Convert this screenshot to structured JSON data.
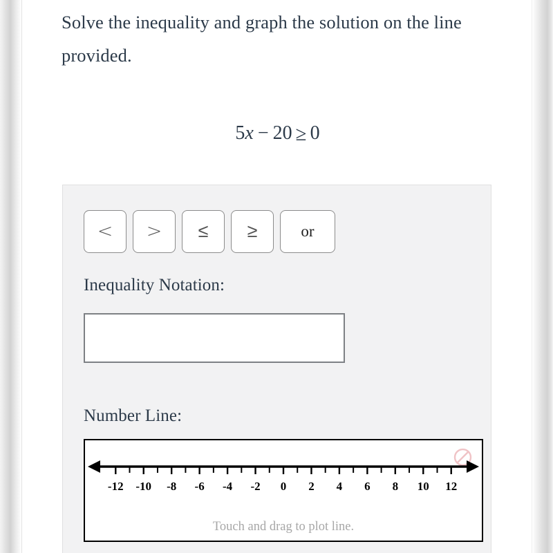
{
  "prompt": {
    "text": "Solve the inequality and graph the solution on the line provided."
  },
  "equation": {
    "full": "5x − 20 ≥ 0",
    "coefficient": "5",
    "variable": "x",
    "operator": "−",
    "constant": "20",
    "relation": "≥",
    "right_side": "0"
  },
  "panel": {
    "operator_keys": [
      {
        "label": "<",
        "name": "less-than"
      },
      {
        "label": ">",
        "name": "greater-than"
      },
      {
        "label": "≤",
        "name": "less-than-or-equal"
      },
      {
        "label": "≥",
        "name": "greater-than-or-equal"
      },
      {
        "label": "or",
        "name": "or"
      }
    ],
    "inequality_notation": {
      "label": "Inequality Notation:",
      "value": "",
      "placeholder": ""
    },
    "number_line": {
      "label": "Number Line:",
      "hint": "Touch and drag to plot line.",
      "clear_icon": "no-entry-icon",
      "clear_icon_color": "#f2c4c6"
    }
  },
  "chart_data": {
    "type": "line",
    "title": "Number Line",
    "xlabel": "",
    "ylabel": "",
    "xlim": [
      -13.2,
      13.2
    ],
    "tick_step": 1,
    "label_step": 2,
    "tick_labels": [
      "-12",
      "-10",
      "-8",
      "-6",
      "-4",
      "-2",
      "0",
      "2",
      "4",
      "6",
      "8",
      "10",
      "12"
    ],
    "labeled_values": [
      -12,
      -10,
      -8,
      -6,
      -4,
      -2,
      0,
      2,
      4,
      6,
      8,
      10,
      12
    ],
    "minor_ticks": [
      -12,
      -11,
      -10,
      -9,
      -8,
      -7,
      -6,
      -5,
      -4,
      -3,
      -2,
      -1,
      0,
      1,
      2,
      3,
      4,
      5,
      6,
      7,
      8,
      9,
      10,
      11,
      12
    ],
    "arrows": "both",
    "grid": false,
    "plotted_points": [],
    "plotted_segments": [],
    "axis_color": "#000000",
    "label_color": "#000000"
  }
}
